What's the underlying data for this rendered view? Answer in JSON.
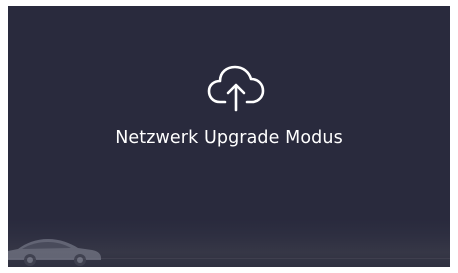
{
  "screen": {
    "title": "Netzwerk Upgrade Modus",
    "icon": "cloud-upload-icon",
    "background_color": "#292a3d",
    "text_color": "#ffffff",
    "icon_color": "#ffffff"
  }
}
